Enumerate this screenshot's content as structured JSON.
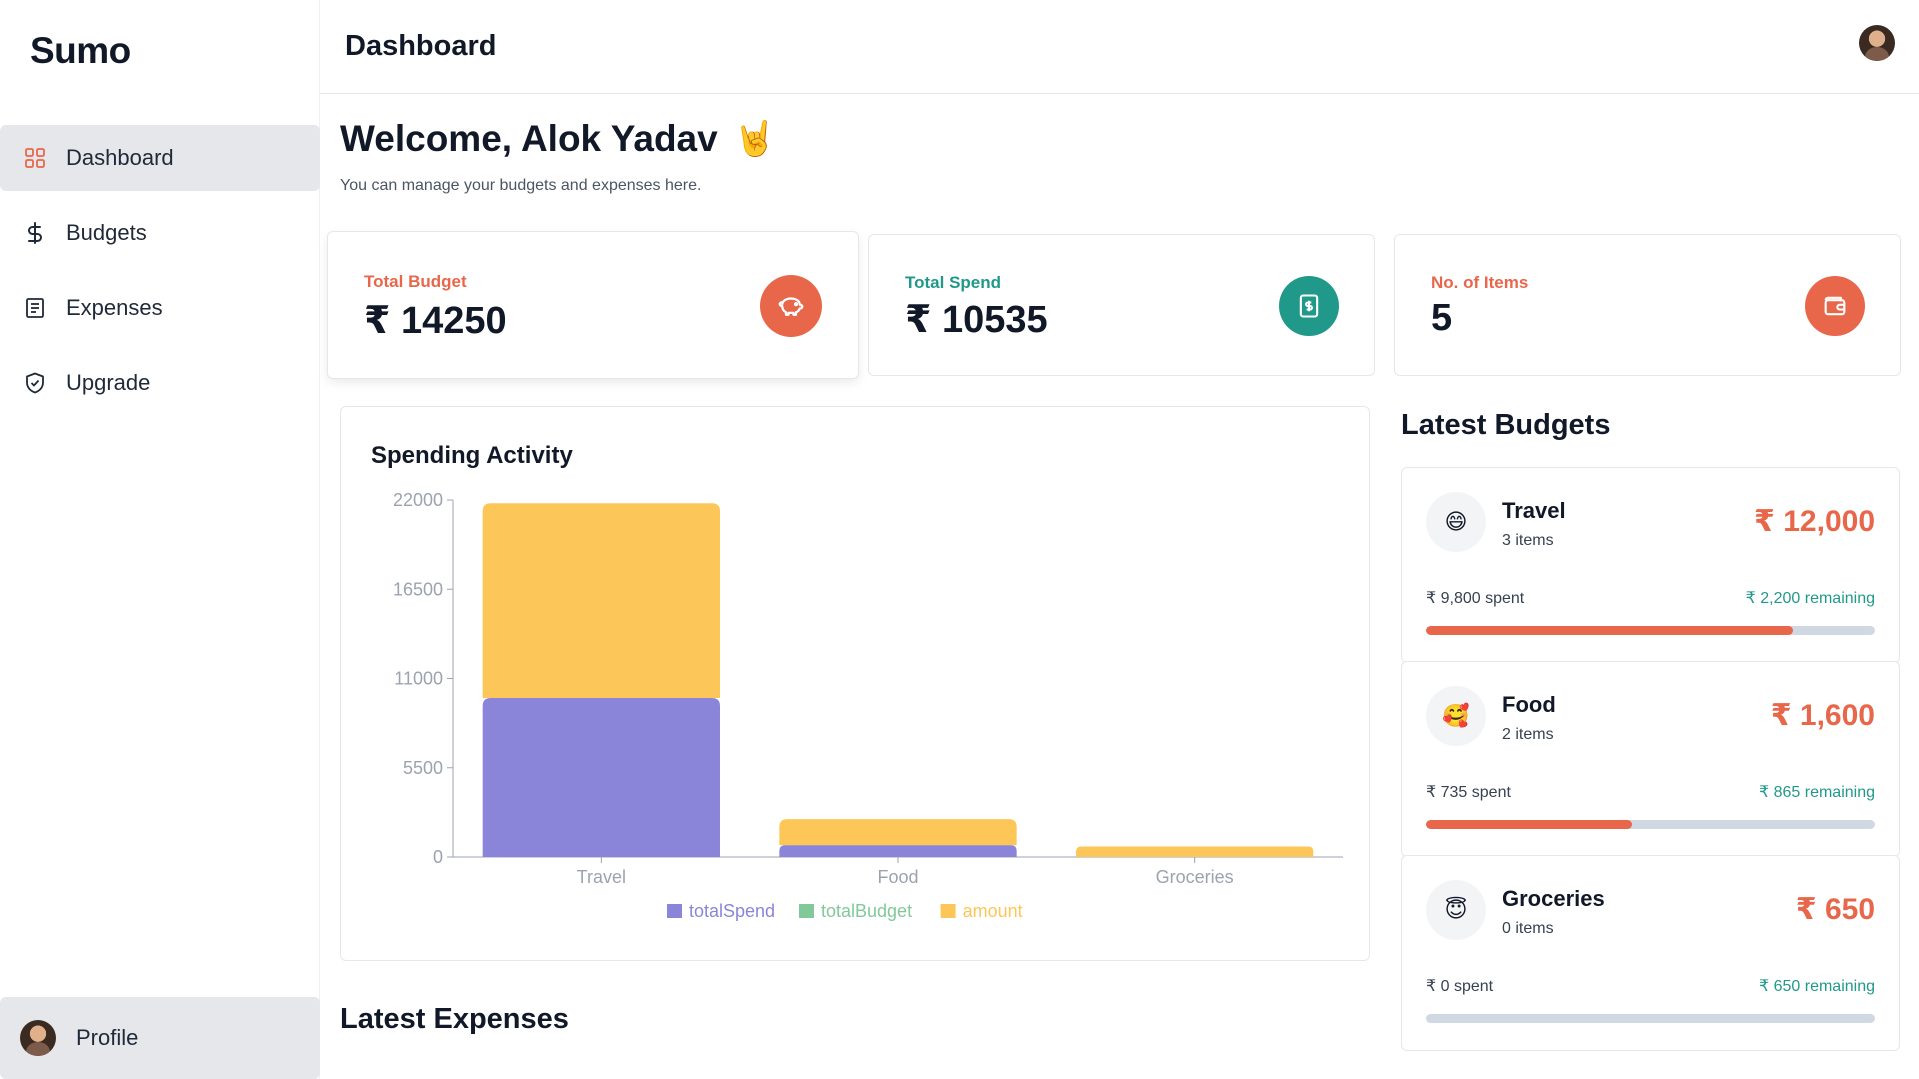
{
  "app": {
    "name": "Sumo"
  },
  "sidebar": {
    "items": [
      {
        "label": "Dashboard",
        "icon": "grid-icon",
        "active": true
      },
      {
        "label": "Budgets",
        "icon": "dollar-icon"
      },
      {
        "label": "Expenses",
        "icon": "receipt-icon"
      },
      {
        "label": "Upgrade",
        "icon": "shield-check-icon"
      }
    ],
    "profile_label": "Profile"
  },
  "header": {
    "title": "Dashboard"
  },
  "welcome": {
    "title": "Welcome, Alok Yadav",
    "emoji": "🤘",
    "subtitle": "You can manage your budgets and expenses here."
  },
  "stats": [
    {
      "label": "Total Budget",
      "value": "₹ 14250",
      "icon": "piggy-bank-icon",
      "color": "#e8674b"
    },
    {
      "label": "Total Spend",
      "value": "₹ 10535",
      "icon": "receipt-dollar-icon",
      "color": "#21998a"
    },
    {
      "label": "No. of Items",
      "value": "5",
      "icon": "wallet-icon",
      "color": "#e8674b"
    }
  ],
  "chart_data": {
    "type": "bar",
    "title": "Spending Activity",
    "stacked": true,
    "categories": [
      "Travel",
      "Food",
      "Groceries"
    ],
    "series": [
      {
        "name": "totalSpend",
        "values": [
          9800,
          735,
          0
        ],
        "color": "#8b85d9"
      },
      {
        "name": "totalBudget",
        "values": [
          0,
          0,
          0
        ],
        "color": "#82c99a"
      },
      {
        "name": "amount",
        "values": [
          12000,
          1600,
          650
        ],
        "color": "#fdc658"
      }
    ],
    "yticks": [
      "0",
      "5500",
      "11000",
      "16500",
      "22000"
    ],
    "ylim": [
      0,
      22000
    ],
    "legend": "bottom"
  },
  "latest_budgets": {
    "title": "Latest Budgets",
    "items": [
      {
        "emoji": "😄",
        "name": "Travel",
        "items": "3 items",
        "amount": "₹ 12,000",
        "spent": "₹ 9,800 spent",
        "remaining": "₹ 2,200 remaining",
        "progress": 0.817
      },
      {
        "emoji": "🥰",
        "name": "Food",
        "items": "2 items",
        "amount": "₹ 1,600",
        "spent": "₹ 735 spent",
        "remaining": "₹ 865 remaining",
        "progress": 0.459
      },
      {
        "emoji": "😇",
        "name": "Groceries",
        "items": "0 items",
        "amount": "₹ 650",
        "spent": "₹ 0 spent",
        "remaining": "₹ 650 remaining",
        "progress": 0
      }
    ]
  },
  "latest_expenses": {
    "title": "Latest Expenses"
  }
}
